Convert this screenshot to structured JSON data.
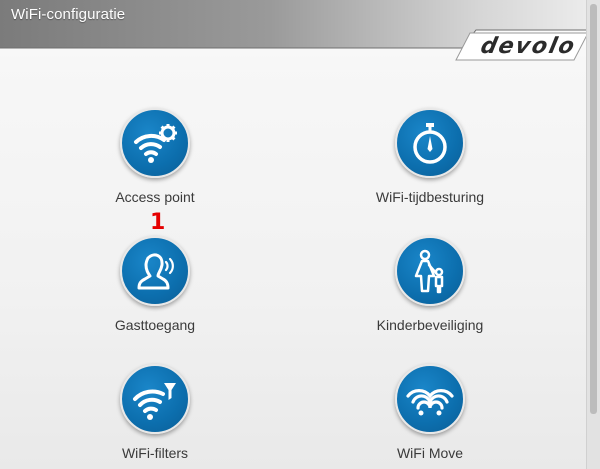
{
  "window": {
    "title": "WiFi-configuratie",
    "logo_text": "devolo"
  },
  "annotation": {
    "marker": "1"
  },
  "tiles": [
    {
      "label": "Access point",
      "icon": "wifi-gear-icon"
    },
    {
      "label": "WiFi-tijdbesturing",
      "icon": "stopwatch-icon"
    },
    {
      "label": "Gasttoegang",
      "icon": "guest-person-icon"
    },
    {
      "label": "Kinderbeveiliging",
      "icon": "parent-child-icon"
    },
    {
      "label": "WiFi-filters",
      "icon": "wifi-filter-icon"
    },
    {
      "label": "WiFi Move",
      "icon": "wifi-move-icon"
    }
  ],
  "colors": {
    "icon_blue": "#0c6ead",
    "marker_red": "#e50000",
    "header_gray": "#8d8d8d"
  }
}
